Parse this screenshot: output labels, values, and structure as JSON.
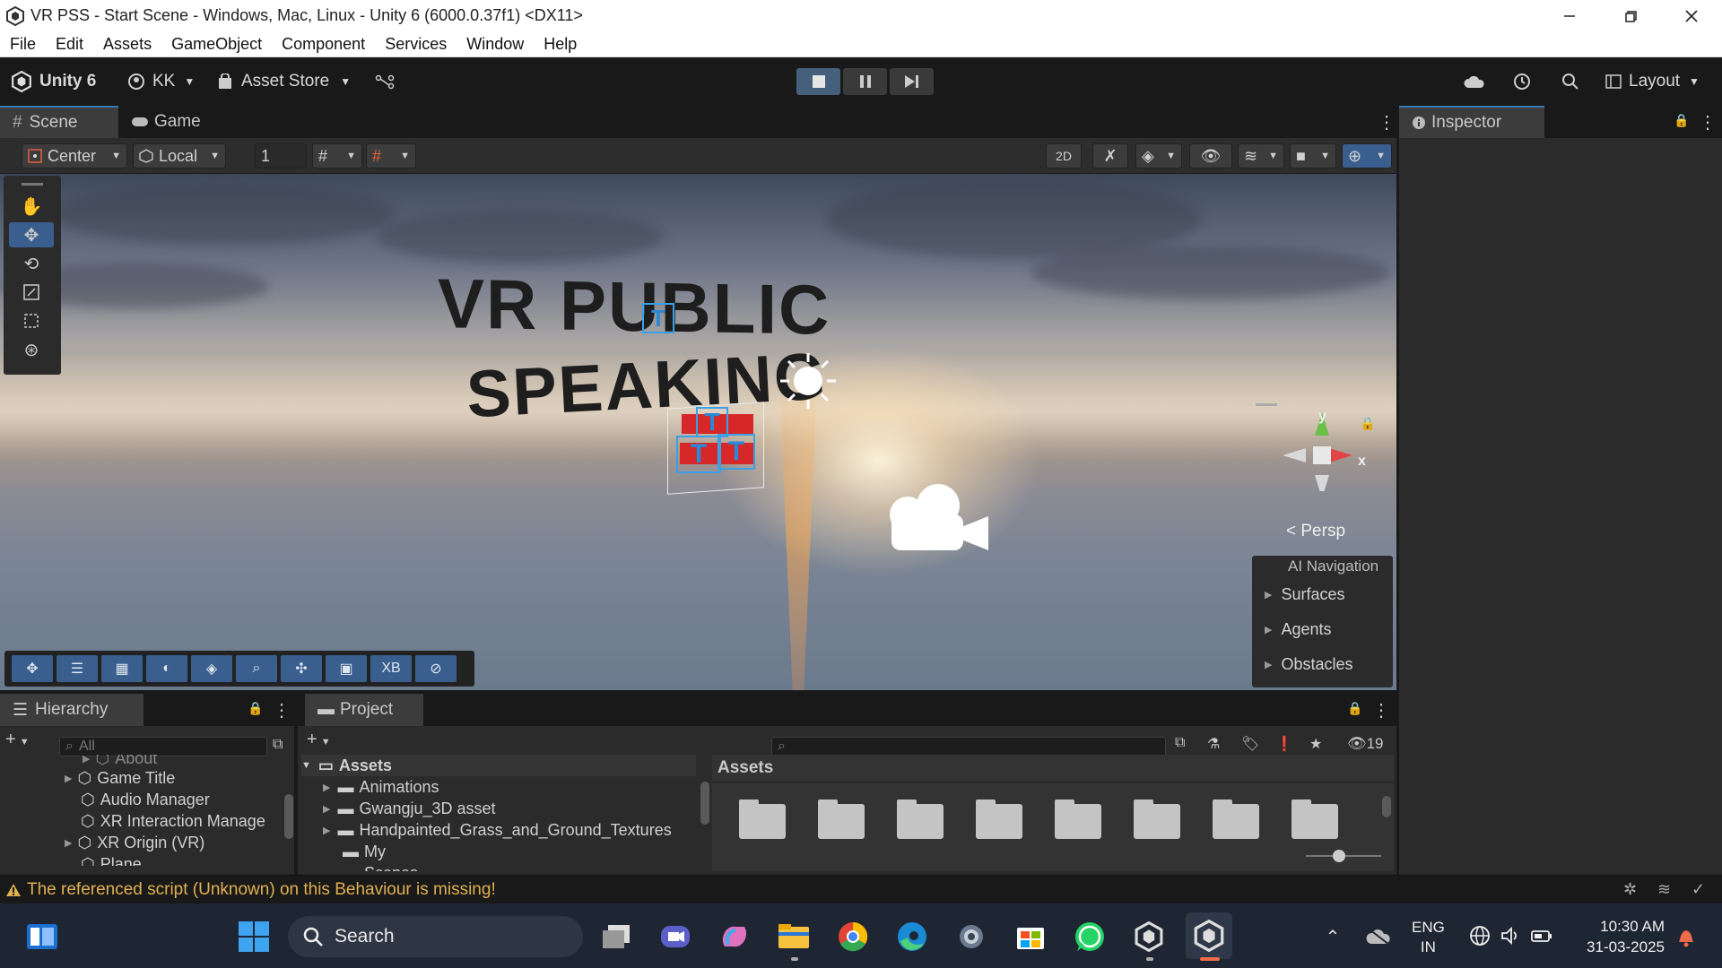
{
  "window": {
    "title": "VR PSS - Start Scene - Windows, Mac, Linux - Unity 6 (6000.0.37f1) <DX11>",
    "controls": [
      "minimize-icon",
      "maximize-icon",
      "close-icon"
    ]
  },
  "menu": [
    "File",
    "Edit",
    "Assets",
    "GameObject",
    "Component",
    "Services",
    "Window",
    "Help"
  ],
  "toolbar": {
    "unity_label": "Unity 6",
    "account": "KK",
    "asset_store": "Asset Store",
    "layout": "Layout"
  },
  "scene_tabs": {
    "scene": "Scene",
    "game": "Game"
  },
  "scene_tools": {
    "pivot": "Center",
    "space": "Local",
    "grid_snap": "1"
  },
  "viewport": {
    "title_line1": "VR PUBLIC",
    "title_line2": "SPEAKING",
    "gizmo_y": "y",
    "gizmo_x": "x",
    "persp": "< Persp"
  },
  "overlay_xb": "XB",
  "ai_navigation": {
    "header": "AI Navigation",
    "items": [
      "Surfaces",
      "Agents",
      "Obstacles"
    ]
  },
  "inspector": {
    "title": "Inspector"
  },
  "hierarchy": {
    "title": "Hierarchy",
    "search_placeholder": "All",
    "rows": [
      {
        "label": "About",
        "indent": 2,
        "arrow": true
      },
      {
        "label": "Game Title",
        "indent": 1,
        "arrow": true
      },
      {
        "label": "Audio Manager",
        "indent": 1,
        "arrow": false
      },
      {
        "label": "XR Interaction Manage",
        "indent": 1,
        "arrow": false
      },
      {
        "label": "XR Origin (VR)",
        "indent": 1,
        "arrow": true
      },
      {
        "label": "Plane",
        "indent": 1,
        "arrow": false
      }
    ]
  },
  "project": {
    "title": "Project",
    "hidden_count": "19",
    "tree": {
      "root": "Assets",
      "children": [
        "Animations",
        "Gwangju_3D asset",
        "Handpainted_Grass_and_Ground_Textures",
        "My",
        "Scenes"
      ]
    },
    "grid_header": "Assets",
    "grid_folder_count": 8
  },
  "status": {
    "message": "The referenced script (Unknown) on this Behaviour is missing!"
  },
  "taskbar": {
    "search": "Search",
    "lang_line1": "ENG",
    "lang_line2": "IN",
    "time": "10:30 AM",
    "date": "31-03-2025"
  }
}
